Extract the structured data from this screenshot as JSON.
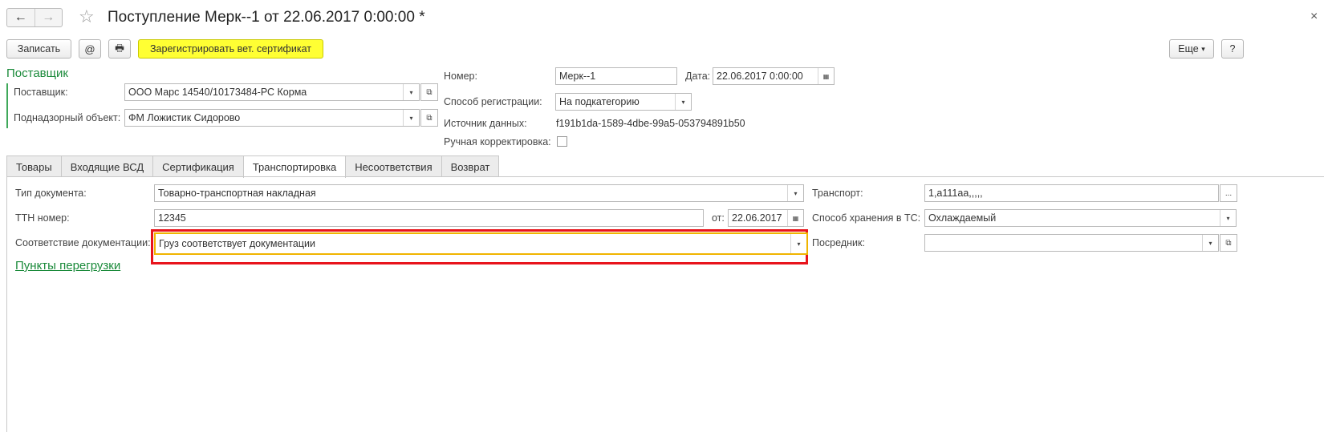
{
  "window": {
    "title": "Поступление Мерк--1 от 22.06.2017 0:00:00 *",
    "back_icon": "←",
    "forward_icon": "→",
    "star_icon": "☆",
    "close_icon": "×"
  },
  "toolbar": {
    "save_label": "Записать",
    "email_icon": "@",
    "print_icon": "🖶",
    "register_label": "Зарегистрировать вет. сертификат",
    "more_label": "Еще",
    "more_arrow": "▾",
    "help_label": "?"
  },
  "supplier_group": {
    "title": "Поставщик",
    "supplier_label": "Поставщик:",
    "supplier_value": "ООО Марс 14540/10173484-РС Корма",
    "object_label": "Поднадзорный объект:",
    "object_value": "ФМ Ложистик Сидорово"
  },
  "header": {
    "number_label": "Номер:",
    "number_value": "Мерк--1",
    "date_label": "Дата:",
    "date_value": "22.06.2017  0:00:00",
    "reg_method_label": "Способ регистрации:",
    "reg_method_value": "На подкатегорию",
    "source_label": "Источник данных:",
    "source_value": "f191b1da-1589-4dbe-99a5-053794891b50",
    "manual_label": "Ручная корректировка:",
    "manual_checked": false
  },
  "tabs": [
    {
      "label": "Товары",
      "active": false
    },
    {
      "label": "Входящие ВСД",
      "active": false
    },
    {
      "label": "Сертификация",
      "active": false
    },
    {
      "label": "Транспортировка",
      "active": true
    },
    {
      "label": "Несоответствия",
      "active": false
    },
    {
      "label": "Возврат",
      "active": false
    }
  ],
  "transport": {
    "doc_type_label": "Тип документа:",
    "doc_type_value": "Товарно-транспортная накладная",
    "ttn_label": "ТТН номер:",
    "ttn_value": "12345",
    "ttn_from_label": "от:",
    "ttn_date_value": "22.06.2017",
    "conformity_label": "Соответствие документации:",
    "conformity_value": "Груз соответствует документации",
    "unload_points_link": "Пункты перегрузки",
    "vehicle_label": "Транспорт:",
    "vehicle_value": "1,а111аа,,,,,",
    "storage_label": "Способ хранения в ТС:",
    "storage_value": "Охлаждаемый",
    "intermediary_label": "Посредник:",
    "intermediary_value": ""
  },
  "icons": {
    "dropdown": "▾",
    "open": "⧉",
    "calendar": "▦",
    "ellipsis": "..."
  },
  "colors": {
    "accent_green": "#1a8a3a",
    "highlight_red": "#e8141c",
    "focus_orange": "#f0b400",
    "register_yellow": "#ffff33"
  }
}
